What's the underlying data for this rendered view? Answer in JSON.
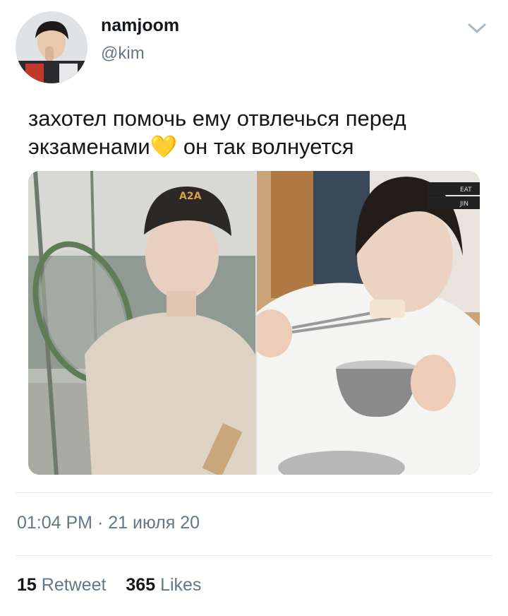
{
  "user": {
    "display_name": "namjoom",
    "handle": "@kim"
  },
  "tweet": {
    "text": " захотел помочь ему отвлечься перед\nэкзаменами💛 он так волнуется",
    "timestamp": "01:04 PM · 21 июля 20"
  },
  "media": {
    "photo_2_stickers": [
      "EAT",
      "JIN"
    ]
  },
  "stats": {
    "retweets_count": "15",
    "retweets_label": "Retweet",
    "likes_count": "365",
    "likes_label": "Likes"
  },
  "icons": {
    "menu": "chevron-down-icon"
  },
  "colors": {
    "text_primary": "#14171a",
    "text_secondary": "#657786",
    "divider": "#e1e8ed",
    "chevron": "#aab8c2"
  }
}
